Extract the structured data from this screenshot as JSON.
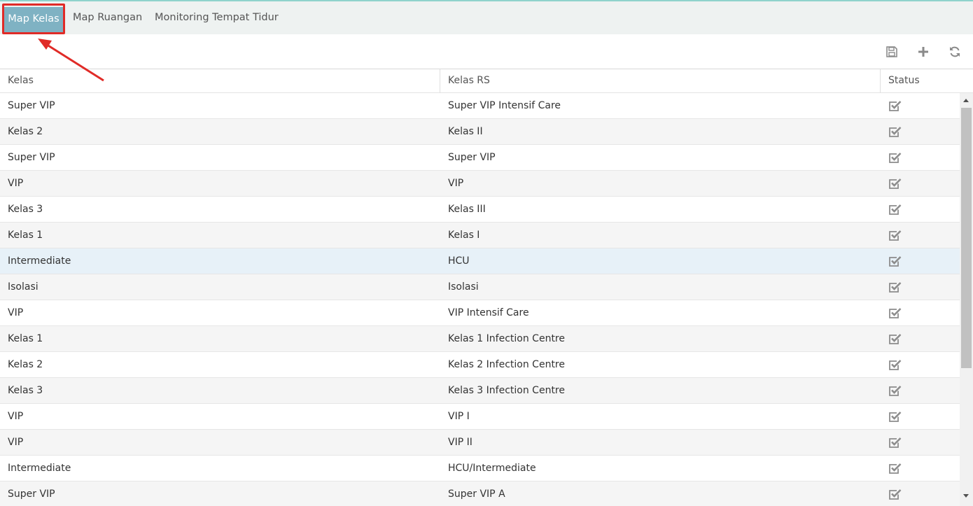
{
  "tabs": [
    {
      "label": "Map Kelas",
      "active": true
    },
    {
      "label": "Map Ruangan",
      "active": false
    },
    {
      "label": "Monitoring Tempat Tidur",
      "active": false
    }
  ],
  "toolbar": {
    "icons": [
      "save-icon",
      "plus-icon",
      "refresh-icon"
    ]
  },
  "grid": {
    "columns": [
      "Kelas",
      "Kelas RS",
      "Status"
    ],
    "rows": [
      {
        "kelas": "Super VIP",
        "kelas_rs": "Super VIP Intensif Care",
        "status": true
      },
      {
        "kelas": "Kelas 2",
        "kelas_rs": "Kelas II",
        "status": true
      },
      {
        "kelas": "Super VIP",
        "kelas_rs": "Super VIP",
        "status": true
      },
      {
        "kelas": "VIP",
        "kelas_rs": "VIP",
        "status": true
      },
      {
        "kelas": "Kelas 3",
        "kelas_rs": "Kelas III",
        "status": true
      },
      {
        "kelas": "Kelas 1",
        "kelas_rs": "Kelas I",
        "status": true
      },
      {
        "kelas": "Intermediate",
        "kelas_rs": "HCU",
        "status": true,
        "selected": true
      },
      {
        "kelas": "Isolasi",
        "kelas_rs": "Isolasi",
        "status": true
      },
      {
        "kelas": "VIP",
        "kelas_rs": "VIP Intensif Care",
        "status": true
      },
      {
        "kelas": "Kelas 1",
        "kelas_rs": "Kelas 1 Infection Centre",
        "status": true
      },
      {
        "kelas": "Kelas 2",
        "kelas_rs": "Kelas 2 Infection Centre",
        "status": true
      },
      {
        "kelas": "Kelas 3",
        "kelas_rs": "Kelas 3 Infection Centre",
        "status": true
      },
      {
        "kelas": "VIP",
        "kelas_rs": "VIP I",
        "status": true
      },
      {
        "kelas": "VIP",
        "kelas_rs": "VIP II",
        "status": true
      },
      {
        "kelas": "Intermediate",
        "kelas_rs": "HCU/Intermediate",
        "status": true
      },
      {
        "kelas": "Super VIP",
        "kelas_rs": "Super VIP A",
        "status": true
      }
    ]
  },
  "colors": {
    "active_tab": "#7fb2c3",
    "highlight": "#e02b27",
    "selected_row": "#e7f1f8"
  }
}
